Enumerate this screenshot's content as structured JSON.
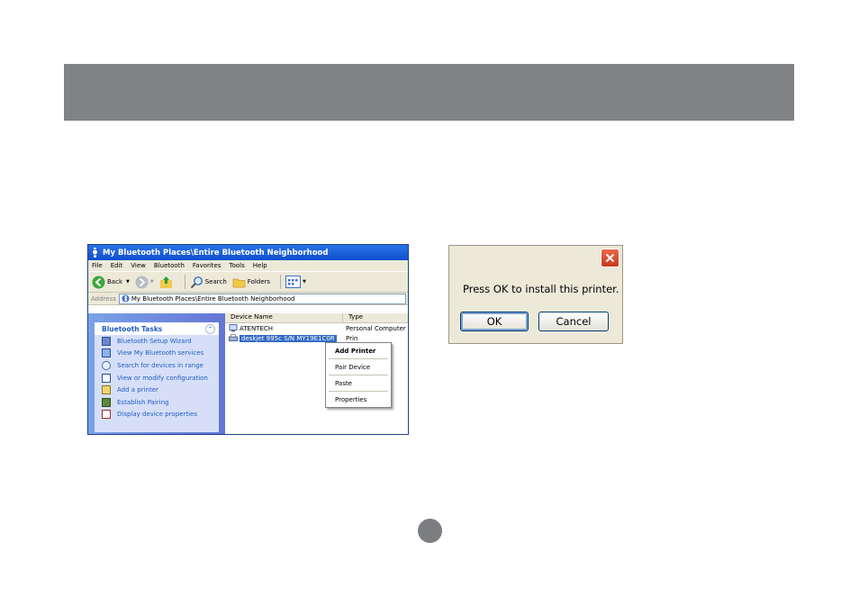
{
  "explorer": {
    "title": "My Bluetooth Places\\Entire Bluetooth Neighborhood",
    "menu": [
      "File",
      "Edit",
      "View",
      "Bluetooth",
      "Favorites",
      "Tools",
      "Help"
    ],
    "toolbar": {
      "back": "Back",
      "search": "Search",
      "folders": "Folders"
    },
    "address": {
      "label": "Address",
      "value": "My Bluetooth Places\\Entire Bluetooth Neighborhood"
    },
    "tasks": {
      "header": "Bluetooth Tasks",
      "items": [
        "Bluetooth Setup Wizard",
        "View My Bluetooth services",
        "Search for devices in range",
        "View or modify configuration",
        "Add a printer",
        "Establish Pairing",
        "Display device properties"
      ]
    },
    "columns": [
      "Device Name",
      "Type"
    ],
    "rows": [
      {
        "name": "ATENTECH",
        "type": "Personal Computer"
      },
      {
        "name": "deskjet 995c S/N MY19E1C0R",
        "type": "Prin"
      }
    ],
    "context_menu": [
      "Add Printer",
      "Pair Device",
      "Paste",
      "Properties"
    ]
  },
  "dialog": {
    "message": "Press OK to install this printer.",
    "ok": "OK",
    "cancel": "Cancel"
  }
}
